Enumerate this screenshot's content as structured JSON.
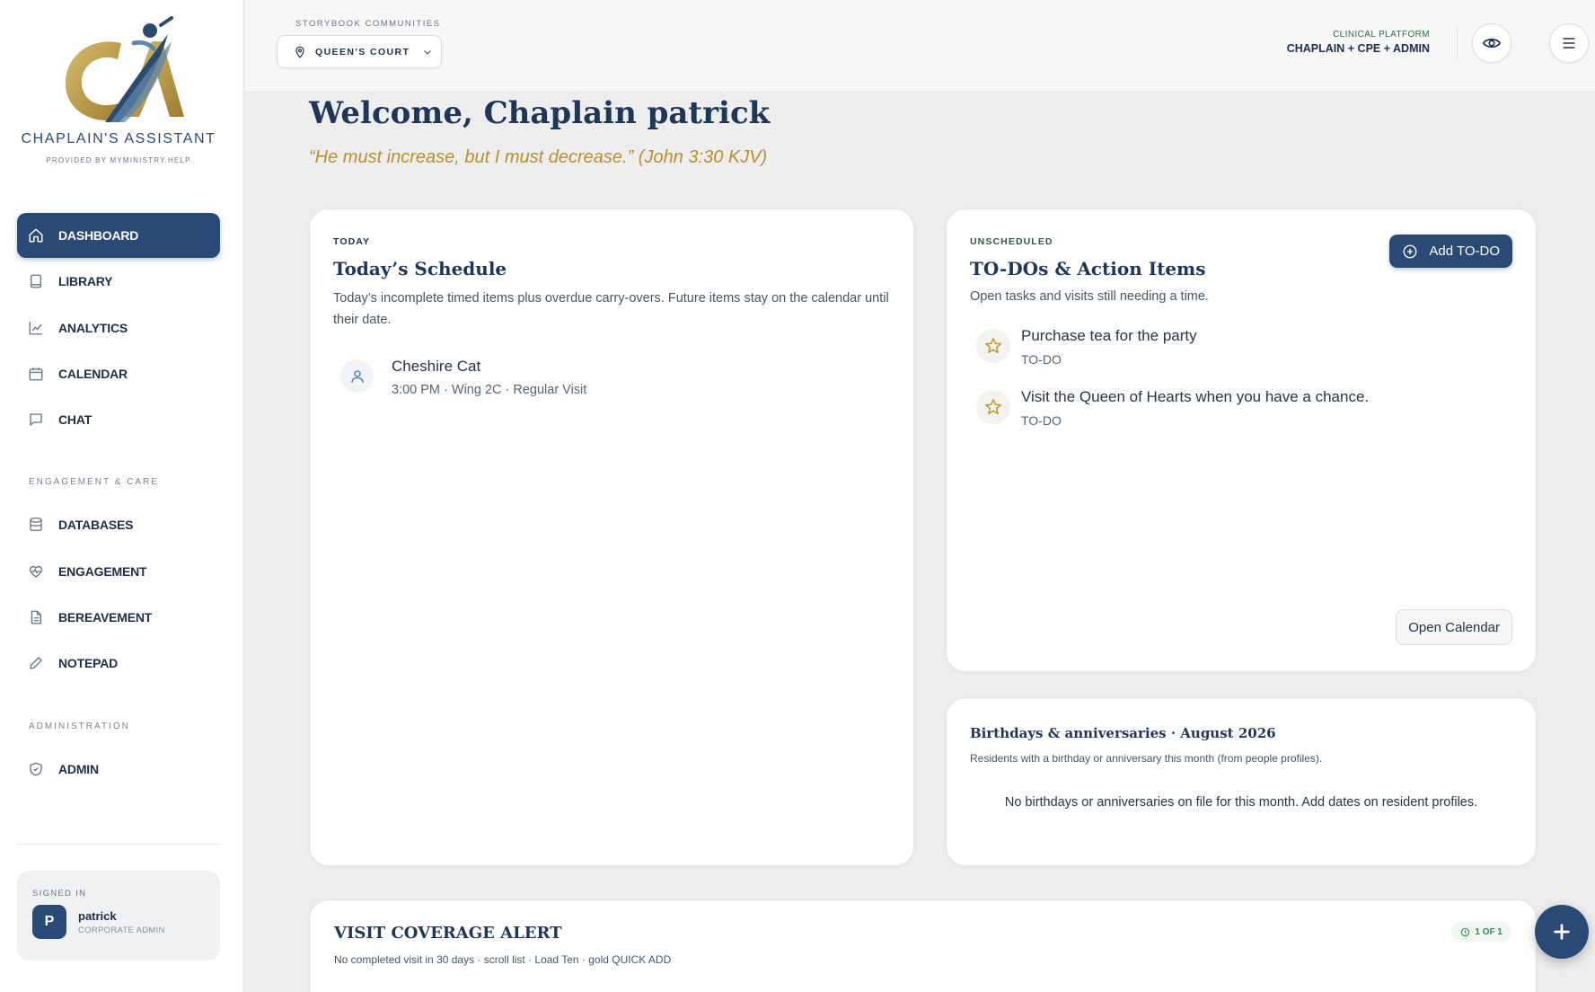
{
  "brand": {
    "name": "CHAPLAIN'S ASSISTANT",
    "provided_by": "PROVIDED BY MYMINISTRY.HELP",
    "logo_letters": "CA",
    "logo_colors": {
      "gold": "#b99a4a",
      "navy": "#2d4a6e",
      "blue": "#5b86ad"
    }
  },
  "sidebar": {
    "items": [
      {
        "label": "DASHBOARD",
        "icon": "home-icon",
        "active": true
      },
      {
        "label": "LIBRARY",
        "icon": "book-icon"
      },
      {
        "label": "ANALYTICS",
        "icon": "chart-icon"
      },
      {
        "label": "CALENDAR",
        "icon": "calendar-icon"
      },
      {
        "label": "CHAT",
        "icon": "chat-icon"
      }
    ],
    "section_engagement": "ENGAGEMENT & CARE",
    "engagement_items": [
      {
        "label": "DATABASES",
        "icon": "database-icon"
      },
      {
        "label": "ENGAGEMENT",
        "icon": "heart-pulse-icon"
      },
      {
        "label": "BEREAVEMENT",
        "icon": "document-icon"
      },
      {
        "label": "NOTEPAD",
        "icon": "pencil-icon"
      }
    ],
    "section_admin": "ADMINISTRATION",
    "admin_items": [
      {
        "label": "ADMIN",
        "icon": "shield-icon"
      }
    ]
  },
  "signin": {
    "label": "SIGNED IN",
    "avatar_letter": "P",
    "name": "patrick",
    "role": "CORPORATE ADMIN"
  },
  "topbar": {
    "community_label": "STORYBOOK COMMUNITIES",
    "community_value": "QUEEN'S COURT",
    "platform_label": "CLINICAL PLATFORM",
    "platform_value": "CHAPLAIN + CPE + ADMIN"
  },
  "main": {
    "welcome": "Welcome, Chaplain patrick",
    "quote": "“He must increase, but I must decrease.” (John 3:30 KJV)"
  },
  "schedule": {
    "kicker": "TODAY",
    "title": "Today’s Schedule",
    "description": "Today’s incomplete timed items plus overdue carry-overs. Future items stay on the calendar until their date.",
    "items": [
      {
        "name": "Cheshire Cat",
        "meta": "3:00 PM · Wing 2C · Regular Visit"
      }
    ]
  },
  "todos": {
    "kicker": "UNSCHEDULED",
    "title": "TO-DOs & Action Items",
    "description": "Open tasks and visits still needing a time.",
    "add_label": "Add TO-DO",
    "items": [
      {
        "title": "Purchase tea for the party",
        "tag": "TO-DO"
      },
      {
        "title": "Visit the Queen of Hearts when you have a chance.",
        "tag": "TO-DO"
      }
    ],
    "open_calendar_label": "Open Calendar"
  },
  "birthdays": {
    "title": "Birthdays & anniversaries · August 2026",
    "description": "Residents with a birthday or anniversary this month (from people profiles).",
    "empty": "No birthdays or anniversaries on file for this month. Add dates on resident profiles."
  },
  "alert": {
    "title": "VISIT COVERAGE ALERT",
    "description": "No completed visit in 30 days · scroll list · Load Ten · gold QUICK ADD",
    "badge": "1 OF 1"
  },
  "fab": {
    "label": "+"
  }
}
